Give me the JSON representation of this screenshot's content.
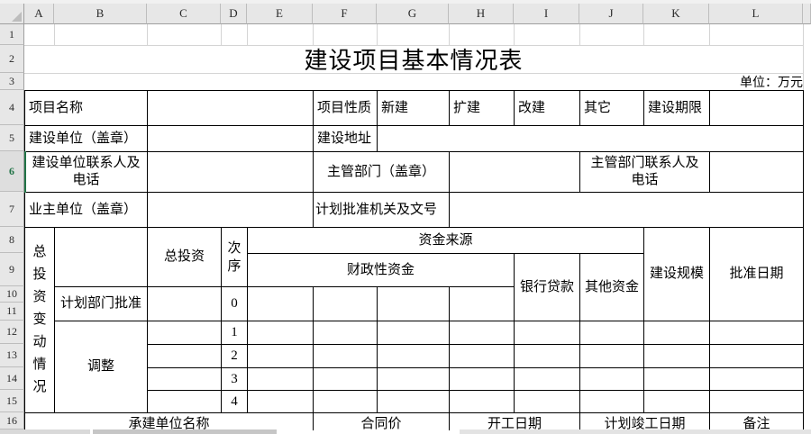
{
  "sheet": {
    "cols": [
      "A",
      "B",
      "C",
      "D",
      "E",
      "F",
      "G",
      "H",
      "I",
      "J",
      "K",
      "L"
    ],
    "rows": [
      "1",
      "2",
      "3",
      "4",
      "5",
      "6",
      "7",
      "8",
      "9",
      "10",
      "11",
      "12",
      "13",
      "14",
      "15",
      "16"
    ],
    "active_row": "6",
    "accent_green": "#217346"
  },
  "title": "建设项目基本情况表",
  "unit_note": "单位：万元",
  "form": {
    "project_name": "项目名称",
    "project_nature": "项目性质",
    "nature_new": "新建",
    "nature_expand": "扩建",
    "nature_rebuild": "改建",
    "nature_other": "其它",
    "construction_period": "建设期限",
    "construction_unit": "建设单位（盖章）",
    "construction_address": "建设地址",
    "construction_unit_contact": "建设单位联系人及电话",
    "competent_dept": "主管部门（盖章）",
    "competent_dept_contact": "主管部门联系人及电话",
    "owner_unit": "业主单位（盖章）",
    "plan_approval_org": "计划批准机关及文号",
    "investment_change_section": "总投资变动情况",
    "total_investment": "总投资",
    "sequence": "次序",
    "funding_source": "资金来源",
    "fiscal_funds": "财政性资金",
    "bank_loan": "银行贷款",
    "other_funds": "其他资金",
    "construction_scale": "建设规模",
    "approval_date": "批准日期",
    "plan_dept_approval": "计划部门批准",
    "adjustment": "调整",
    "seq": [
      "0",
      "1",
      "2",
      "3",
      "4"
    ],
    "contractor_name": "承建单位名称",
    "contract_price": "合同价",
    "start_date": "开工日期",
    "planned_completion_date": "计划竣工日期",
    "remarks": "备注"
  }
}
